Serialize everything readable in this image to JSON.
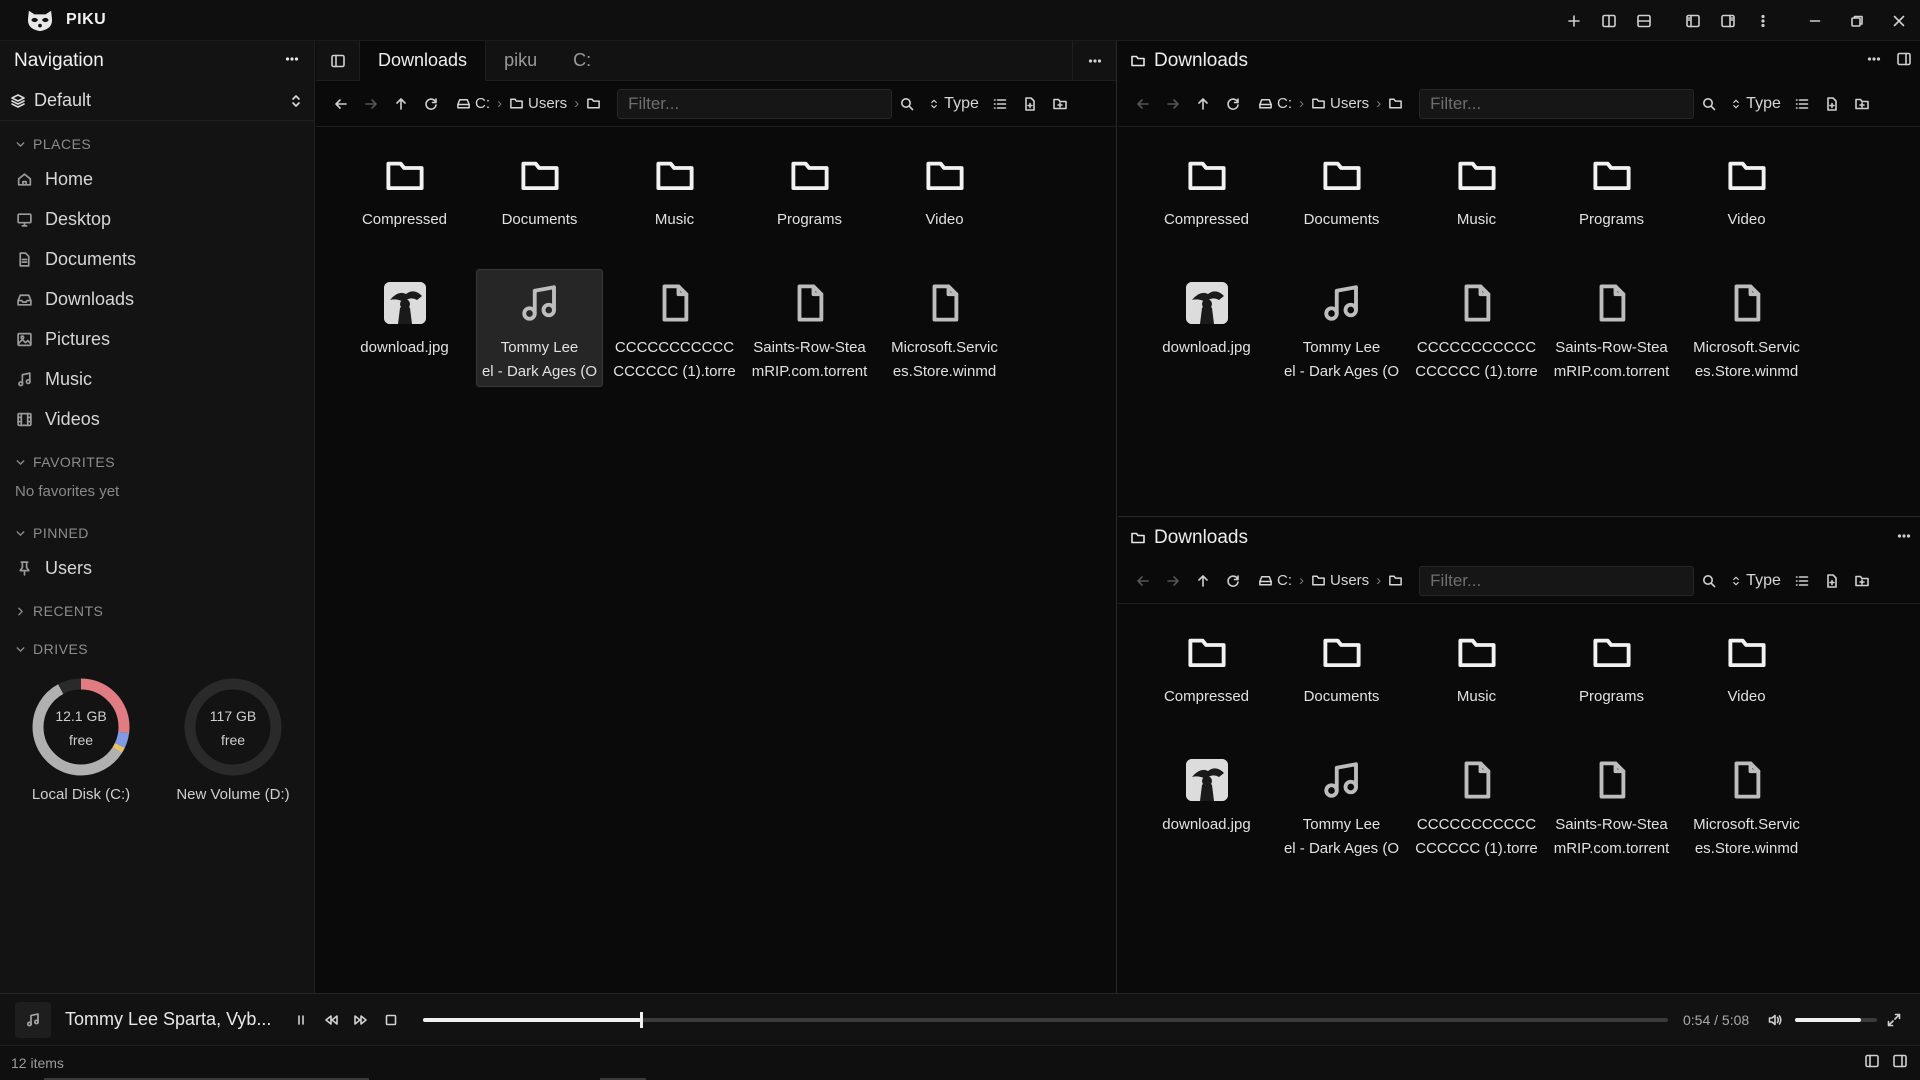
{
  "app": {
    "title": "PIKU"
  },
  "sidebar": {
    "title": "Navigation",
    "profile": "Default",
    "places_label": "PLACES",
    "places": [
      {
        "label": "Home",
        "icon": "home-icon"
      },
      {
        "label": "Desktop",
        "icon": "desktop-icon"
      },
      {
        "label": "Documents",
        "icon": "documents-icon"
      },
      {
        "label": "Downloads",
        "icon": "downloads-icon"
      },
      {
        "label": "Pictures",
        "icon": "pictures-icon"
      },
      {
        "label": "Music",
        "icon": "music-icon"
      },
      {
        "label": "Videos",
        "icon": "videos-icon"
      }
    ],
    "favorites_label": "FAVORITES",
    "favorites_empty": "No favorites yet",
    "pinned_label": "PINNED",
    "pinned": [
      {
        "label": "Users",
        "icon": "pin-icon"
      }
    ],
    "recents_label": "RECENTS",
    "drives_label": "DRIVES",
    "drives": [
      {
        "size": "12.1 GB",
        "free_label": "free",
        "label": "Local Disk (C:)",
        "free_fraction": 0.08,
        "segments": [
          {
            "color": "#e07c82",
            "fraction": 0.27
          },
          {
            "color": "#7f9be3",
            "fraction": 0.05
          },
          {
            "color": "#e6c36a",
            "fraction": 0.02
          },
          {
            "color": "#b0b0b0",
            "fraction": 0.58
          }
        ]
      },
      {
        "size": "117 GB",
        "free_label": "free",
        "label": "New Volume (D:)",
        "free_fraction": 1.0,
        "segments": []
      }
    ]
  },
  "left_pane": {
    "tabs": [
      "Downloads",
      "piku",
      "C:"
    ],
    "active_tab": 0
  },
  "right_top_pane": {
    "title": "Downloads"
  },
  "right_bottom_pane": {
    "title": "Downloads"
  },
  "breadcrumb": {
    "drive": "C:",
    "users": "Users"
  },
  "filter": {
    "placeholder": "Filter..."
  },
  "sort": {
    "label": "Type"
  },
  "files": [
    {
      "name": "Compressed",
      "kind": "folder"
    },
    {
      "name": "Documents",
      "kind": "folder"
    },
    {
      "name": "Music",
      "kind": "folder"
    },
    {
      "name": "Programs",
      "kind": "folder"
    },
    {
      "name": "Video",
      "kind": "folder"
    },
    {
      "name": "download.jpg",
      "kind": "image"
    },
    {
      "name": "Tommy Lee",
      "name2": "el - Dark Ages (O",
      "kind": "music"
    },
    {
      "name": "CCCCCCCCCCC",
      "name2": "CCCCCC (1).torre",
      "kind": "file"
    },
    {
      "name": "Saints-Row-Stea",
      "name2": "mRIP.com.torrent",
      "kind": "file"
    },
    {
      "name": "Microsoft.Servic",
      "name2": "es.Store.winmd",
      "kind": "file"
    }
  ],
  "player": {
    "title": "Tommy Lee Sparta, Vyb...",
    "time": "0:54 / 5:08",
    "progress": 0.175,
    "volume": 0.8
  },
  "status": {
    "count": "12 items"
  },
  "colors": {
    "background": "#0a0a0a",
    "sidebar": "#131313",
    "selection": "#262626",
    "accent": "#f0f0f0"
  }
}
